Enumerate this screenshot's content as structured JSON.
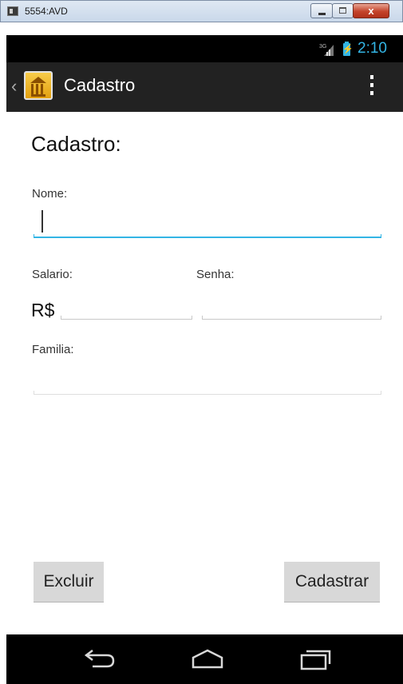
{
  "window": {
    "title": "5554:AVD",
    "close_glyph": "x"
  },
  "status_bar": {
    "network": "3G",
    "time": "2:10"
  },
  "action_bar": {
    "title": "Cadastro",
    "up_glyph": "‹"
  },
  "form": {
    "heading": "Cadastro:",
    "nome_label": "Nome:",
    "nome_value": "",
    "salario_label": "Salario:",
    "currency_prefix": "R$",
    "salario_value": "",
    "senha_label": "Senha:",
    "senha_value": "",
    "familia_label": "Familia:",
    "familia_value": ""
  },
  "buttons": {
    "delete_label": "Excluir",
    "register_label": "Cadastrar"
  },
  "navigation": {
    "icons": [
      "back-icon",
      "home-icon",
      "recent-apps-icon"
    ]
  },
  "colors": {
    "accent": "#33b5e5",
    "action_bar": "#222222",
    "button": "#d8d8d8"
  }
}
